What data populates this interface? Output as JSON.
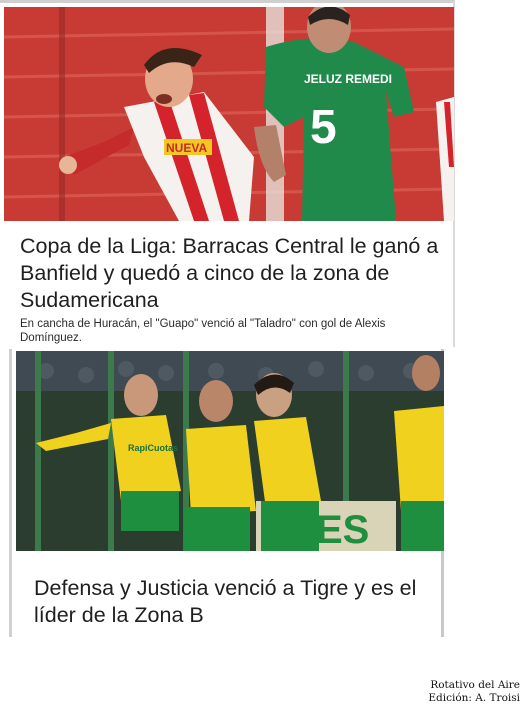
{
  "articles": [
    {
      "headline": "Copa de la Liga: Barracas Central le ganó a Banfield y quedó a cinco de la zona de Sudamericana",
      "summary": "En cancha de Huracán, el \"Guapo\" venció al \"Taladro\" con gol de Alexis Domínguez.",
      "photo": {
        "jersey_name": "JELUZ REMEDI",
        "jersey_number": "5",
        "shirt_sponsor": "NUEVA",
        "colors": {
          "stand": "#c83b35",
          "home_stripe": "#d5232b",
          "away_kit": "#1f8a4a"
        }
      }
    },
    {
      "headline": "Defensa y Justicia venció a Tigre y es el líder de la Zona B",
      "photo": {
        "shirt_sponsor": "RapiCuotas",
        "banner_text": "ES",
        "colors": {
          "kit_yellow": "#f0d21e",
          "kit_green": "#1e8f3e",
          "crowd": "#2b3d2f"
        }
      }
    }
  ],
  "credit": {
    "line1": "Rotativo del Aire",
    "line2": "Edición: A. Troisi"
  }
}
